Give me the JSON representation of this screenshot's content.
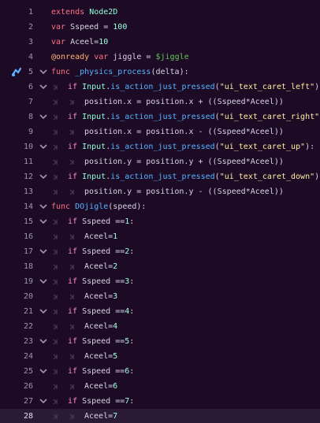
{
  "editor": {
    "lines": [
      {
        "n": "1",
        "indent": 0,
        "tokens": [
          {
            "c": "kw",
            "t": "extends"
          },
          {
            "c": "plain",
            "t": " "
          },
          {
            "c": "ty",
            "t": "Node2D"
          }
        ]
      },
      {
        "n": "2",
        "indent": 0,
        "tokens": [
          {
            "c": "kw",
            "t": "var"
          },
          {
            "c": "plain",
            "t": " Sspeed = "
          },
          {
            "c": "num",
            "t": "100"
          }
        ]
      },
      {
        "n": "3",
        "indent": 0,
        "tokens": [
          {
            "c": "kw",
            "t": "var"
          },
          {
            "c": "plain",
            "t": " Aceel="
          },
          {
            "c": "num",
            "t": "10"
          }
        ]
      },
      {
        "n": "4",
        "indent": 0,
        "tokens": [
          {
            "c": "ann",
            "t": "@onready"
          },
          {
            "c": "plain",
            "t": " "
          },
          {
            "c": "kw",
            "t": "var"
          },
          {
            "c": "plain",
            "t": " jiggle = "
          },
          {
            "c": "node",
            "t": "$jiggle"
          }
        ]
      },
      {
        "n": "5",
        "indent": 0,
        "fold": true,
        "override_icon": true,
        "tokens": [
          {
            "c": "kw",
            "t": "func"
          },
          {
            "c": "plain",
            "t": " "
          },
          {
            "c": "fn",
            "t": "_physics_process"
          },
          {
            "c": "plain",
            "t": "(delta):"
          }
        ]
      },
      {
        "n": "6",
        "indent": 1,
        "fold": true,
        "tokens": [
          {
            "c": "ctl",
            "t": "if"
          },
          {
            "c": "plain",
            "t": " "
          },
          {
            "c": "ty",
            "t": "Input"
          },
          {
            "c": "plain",
            "t": "."
          },
          {
            "c": "fn",
            "t": "is_action_just_pressed"
          },
          {
            "c": "plain",
            "t": "("
          },
          {
            "c": "str",
            "t": "\"ui_text_caret_left\""
          },
          {
            "c": "plain",
            "t": "):"
          }
        ]
      },
      {
        "n": "7",
        "indent": 2,
        "tokens": [
          {
            "c": "plain",
            "t": "position.x = position.x + ((Sspeed*Aceel))"
          }
        ]
      },
      {
        "n": "8",
        "indent": 1,
        "fold": true,
        "tokens": [
          {
            "c": "ctl",
            "t": "if"
          },
          {
            "c": "plain",
            "t": " "
          },
          {
            "c": "ty",
            "t": "Input"
          },
          {
            "c": "plain",
            "t": "."
          },
          {
            "c": "fn",
            "t": "is_action_just_pressed"
          },
          {
            "c": "plain",
            "t": "("
          },
          {
            "c": "str",
            "t": "\"ui_text_caret_right\""
          },
          {
            "c": "plain",
            "t": "):"
          }
        ]
      },
      {
        "n": "9",
        "indent": 2,
        "tokens": [
          {
            "c": "plain",
            "t": "position.x = position.x - ((Sspeed*Aceel))"
          }
        ]
      },
      {
        "n": "10",
        "indent": 1,
        "fold": true,
        "tokens": [
          {
            "c": "ctl",
            "t": "if"
          },
          {
            "c": "plain",
            "t": " "
          },
          {
            "c": "ty",
            "t": "Input"
          },
          {
            "c": "plain",
            "t": "."
          },
          {
            "c": "fn",
            "t": "is_action_just_pressed"
          },
          {
            "c": "plain",
            "t": "("
          },
          {
            "c": "str",
            "t": "\"ui_text_caret_up\""
          },
          {
            "c": "plain",
            "t": "):"
          }
        ]
      },
      {
        "n": "11",
        "indent": 2,
        "tokens": [
          {
            "c": "plain",
            "t": "position.y = position.y + ((Sspeed*Aceel))"
          }
        ]
      },
      {
        "n": "12",
        "indent": 1,
        "fold": true,
        "tokens": [
          {
            "c": "ctl",
            "t": "if"
          },
          {
            "c": "plain",
            "t": " "
          },
          {
            "c": "ty",
            "t": "Input"
          },
          {
            "c": "plain",
            "t": "."
          },
          {
            "c": "fn",
            "t": "is_action_just_pressed"
          },
          {
            "c": "plain",
            "t": "("
          },
          {
            "c": "str",
            "t": "\"ui_text_caret_down\""
          },
          {
            "c": "plain",
            "t": "):"
          }
        ]
      },
      {
        "n": "13",
        "indent": 2,
        "tokens": [
          {
            "c": "plain",
            "t": "position.y = position.y - ((Sspeed*Aceel))"
          }
        ]
      },
      {
        "n": "14",
        "indent": 0,
        "fold": true,
        "tokens": [
          {
            "c": "kw",
            "t": "func"
          },
          {
            "c": "plain",
            "t": " "
          },
          {
            "c": "fn",
            "t": "DOjigle"
          },
          {
            "c": "plain",
            "t": "(speed):"
          }
        ]
      },
      {
        "n": "15",
        "indent": 1,
        "fold": true,
        "tokens": [
          {
            "c": "ctl",
            "t": "if"
          },
          {
            "c": "plain",
            "t": " Sspeed =="
          },
          {
            "c": "num",
            "t": "1"
          },
          {
            "c": "plain",
            "t": ":"
          }
        ]
      },
      {
        "n": "16",
        "indent": 2,
        "tokens": [
          {
            "c": "plain",
            "t": "Aceel="
          },
          {
            "c": "num",
            "t": "1"
          }
        ]
      },
      {
        "n": "17",
        "indent": 1,
        "fold": true,
        "tokens": [
          {
            "c": "ctl",
            "t": "if"
          },
          {
            "c": "plain",
            "t": " Sspeed =="
          },
          {
            "c": "num",
            "t": "2"
          },
          {
            "c": "plain",
            "t": ":"
          }
        ]
      },
      {
        "n": "18",
        "indent": 2,
        "tokens": [
          {
            "c": "plain",
            "t": "Aceel="
          },
          {
            "c": "num",
            "t": "2"
          }
        ]
      },
      {
        "n": "19",
        "indent": 1,
        "fold": true,
        "tokens": [
          {
            "c": "ctl",
            "t": "if"
          },
          {
            "c": "plain",
            "t": " Sspeed =="
          },
          {
            "c": "num",
            "t": "3"
          },
          {
            "c": "plain",
            "t": ":"
          }
        ]
      },
      {
        "n": "20",
        "indent": 2,
        "tokens": [
          {
            "c": "plain",
            "t": "Aceel="
          },
          {
            "c": "num",
            "t": "3"
          }
        ]
      },
      {
        "n": "21",
        "indent": 1,
        "fold": true,
        "tokens": [
          {
            "c": "ctl",
            "t": "if"
          },
          {
            "c": "plain",
            "t": " Sspeed =="
          },
          {
            "c": "num",
            "t": "4"
          },
          {
            "c": "plain",
            "t": ":"
          }
        ]
      },
      {
        "n": "22",
        "indent": 2,
        "tokens": [
          {
            "c": "plain",
            "t": "Aceel="
          },
          {
            "c": "num",
            "t": "4"
          }
        ]
      },
      {
        "n": "23",
        "indent": 1,
        "fold": true,
        "tokens": [
          {
            "c": "ctl",
            "t": "if"
          },
          {
            "c": "plain",
            "t": " Sspeed =="
          },
          {
            "c": "num",
            "t": "5"
          },
          {
            "c": "plain",
            "t": ":"
          }
        ]
      },
      {
        "n": "24",
        "indent": 2,
        "tokens": [
          {
            "c": "plain",
            "t": "Aceel="
          },
          {
            "c": "num",
            "t": "5"
          }
        ]
      },
      {
        "n": "25",
        "indent": 1,
        "fold": true,
        "tokens": [
          {
            "c": "ctl",
            "t": "if"
          },
          {
            "c": "plain",
            "t": " Sspeed =="
          },
          {
            "c": "num",
            "t": "6"
          },
          {
            "c": "plain",
            "t": ":"
          }
        ]
      },
      {
        "n": "26",
        "indent": 2,
        "tokens": [
          {
            "c": "plain",
            "t": "Aceel="
          },
          {
            "c": "num",
            "t": "6"
          }
        ]
      },
      {
        "n": "27",
        "indent": 1,
        "fold": true,
        "tokens": [
          {
            "c": "ctl",
            "t": "if"
          },
          {
            "c": "plain",
            "t": " Sspeed =="
          },
          {
            "c": "num",
            "t": "7"
          },
          {
            "c": "plain",
            "t": ":"
          }
        ]
      },
      {
        "n": "28",
        "indent": 2,
        "current": true,
        "tokens": [
          {
            "c": "plain",
            "t": "Aceel="
          },
          {
            "c": "num",
            "t": "7"
          }
        ]
      }
    ]
  },
  "colors": {
    "background": "#1d0b26",
    "current_line": "#2a1a35",
    "keyword": "#ff7085",
    "control": "#ff8ccc",
    "type": "#8effda",
    "function": "#57b3ff",
    "string": "#ffeda1",
    "number": "#a1ffe0",
    "annotation": "#ffb373",
    "node_path": "#63c259"
  },
  "icons": {
    "override": "override-method-icon",
    "fold": "chevron-down-icon",
    "tab": "tab-indent-icon"
  }
}
